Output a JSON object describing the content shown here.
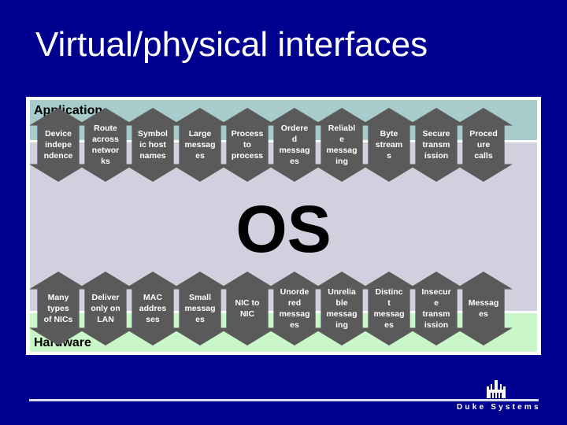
{
  "title": "Virtual/physical interfaces",
  "diagram": {
    "top_label": "Application",
    "middle_label": "OS",
    "bottom_label": "Hardware",
    "top_arrows": [
      "Device\nindepe\nndence",
      "Route\nacross\nnetwor\nks",
      "Symbol\nic host\nnames",
      "Large\nmessag\nes",
      "Process\nto\nprocess",
      "Ordere\nd\nmessag\nes",
      "Reliabl\ne\nmessag\ning",
      "Byte\nstream\ns",
      "Secure\ntransm\nission",
      "Proced\nure\ncalls"
    ],
    "bottom_arrows": [
      "Many\ntypes\nof NICs",
      "Deliver\nonly on\nLAN",
      "MAC\naddres\nses",
      "Small\nmessag\nes",
      "NIC to\nNIC",
      "Unorde\nred\nmessag\nes",
      "Unrelia\nble\nmessag\ning",
      "Distinc\nt\nmessag\nes",
      "Insecur\ne\ntransm\nission",
      "Messag\nes"
    ],
    "colors": {
      "background": "#00008e",
      "arrow": "#5a5a5a",
      "application": "#a8cccc",
      "os": "#d0d0de",
      "hardware": "#c9f7c9"
    }
  },
  "footer": {
    "brand": "Duke Systems",
    "logo_icon": "duke-chapel-icon"
  }
}
